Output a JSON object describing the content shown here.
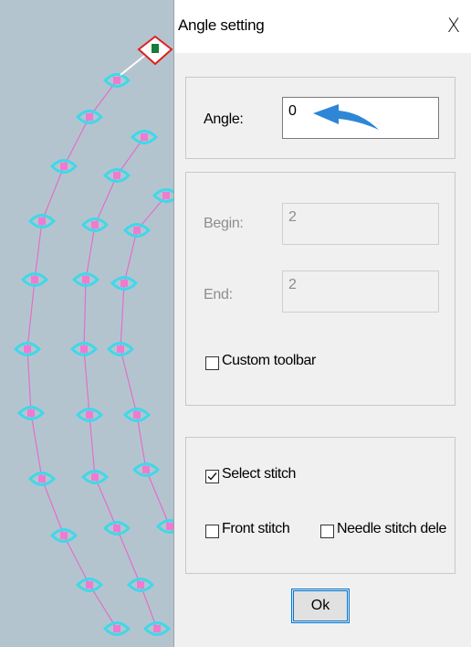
{
  "dialog": {
    "title": "Angle setting",
    "close_label": "X",
    "angle": {
      "label": "Angle:",
      "value": "0"
    },
    "begin": {
      "label": "Begin:",
      "value": "2"
    },
    "end": {
      "label": "End:",
      "value": "2"
    },
    "custom_toolbar": {
      "label": "Custom toolbar",
      "checked": false
    },
    "select_stitch": {
      "label": "Select stitch",
      "checked": true
    },
    "front_stitch": {
      "label": "Front stitch",
      "checked": false
    },
    "needle_stitch_delete": {
      "label": "Needle stitch dele",
      "checked": false
    },
    "ok_label": "Ok"
  },
  "colors": {
    "canvas_bg": "#b4c4cf",
    "stitch_line": "#e070c8",
    "stitch_marker_outline": "#40d8e8",
    "stitch_point": "#f07ad0",
    "selected_marker": "#e02020",
    "arrow": "#2f86d6"
  }
}
